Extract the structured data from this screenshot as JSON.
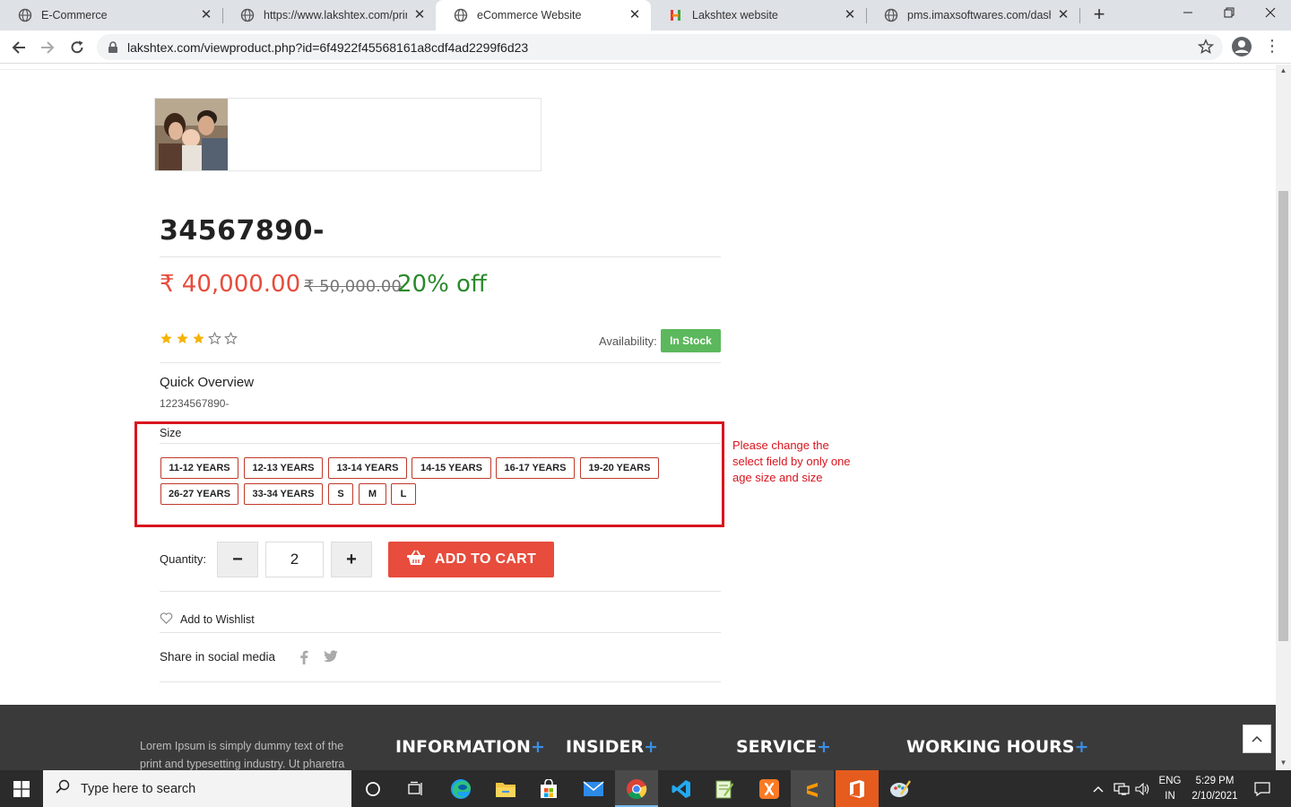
{
  "browser": {
    "tabs": [
      {
        "title": "E-Commerce",
        "icon": "globe-icon",
        "active": false
      },
      {
        "title": "https://www.lakshtex.com/printorder",
        "icon": "globe-icon",
        "active": false
      },
      {
        "title": "eCommerce Website",
        "icon": "globe-icon",
        "active": true
      },
      {
        "title": "Lakshtex website",
        "icon": "lakshtex-logo-icon",
        "active": false
      },
      {
        "title": "pms.imaxsoftwares.com/dashboard",
        "icon": "globe-icon",
        "active": false
      }
    ],
    "close_glyph": "✕",
    "new_tab_glyph": "+",
    "url": "lakshtex.com/viewproduct.php?id=6f4922f45568161a8cdf4ad2299f6d23"
  },
  "product": {
    "title": "34567890-",
    "price": "₹ 40,000.00",
    "old_price": "₹ 50,000.00",
    "discount": "20% off",
    "rating": 3,
    "rating_max": 5,
    "availability_label": "Availability:",
    "availability": "In Stock",
    "quick_overview_title": "Quick Overview",
    "quick_overview_text": "12234567890-",
    "size_label": "Size",
    "sizes": [
      "11-12 YEARS",
      "12-13 YEARS",
      "13-14 YEARS",
      "14-15 YEARS",
      "16-17 YEARS",
      "19-20 YEARS",
      "26-27 YEARS",
      "33-34 YEARS",
      "S",
      "M",
      "L"
    ],
    "annotation_note": "Please change the select field by only one age size and size",
    "quantity_label": "Quantity:",
    "quantity": "2",
    "minus": "−",
    "plus": "+",
    "add_to_cart": "ADD TO CART",
    "wishlist": "Add to Wishlist",
    "share_label": "Share in social media"
  },
  "footer": {
    "about": "Lorem Ipsum is simply dummy text of the print and typesetting industry. Ut pharetra",
    "headings": [
      "INFORMATION",
      "INSIDER",
      "SERVICE",
      "WORKING HOURS"
    ],
    "plus": "+"
  },
  "taskbar": {
    "search_placeholder": "Type here to search",
    "lang_line1": "ENG",
    "lang_line2": "IN",
    "time": "5:29 PM",
    "date": "2/10/2021"
  },
  "colors": {
    "price_red": "#e74c3c",
    "discount_green": "#2a8a2a",
    "instock_green": "#5cb85c",
    "annotation_red": "#d9141e",
    "star_gold": "#f5b301",
    "footer_bg": "#3a3a3a",
    "footer_plus_blue": "#3a8fe5"
  }
}
